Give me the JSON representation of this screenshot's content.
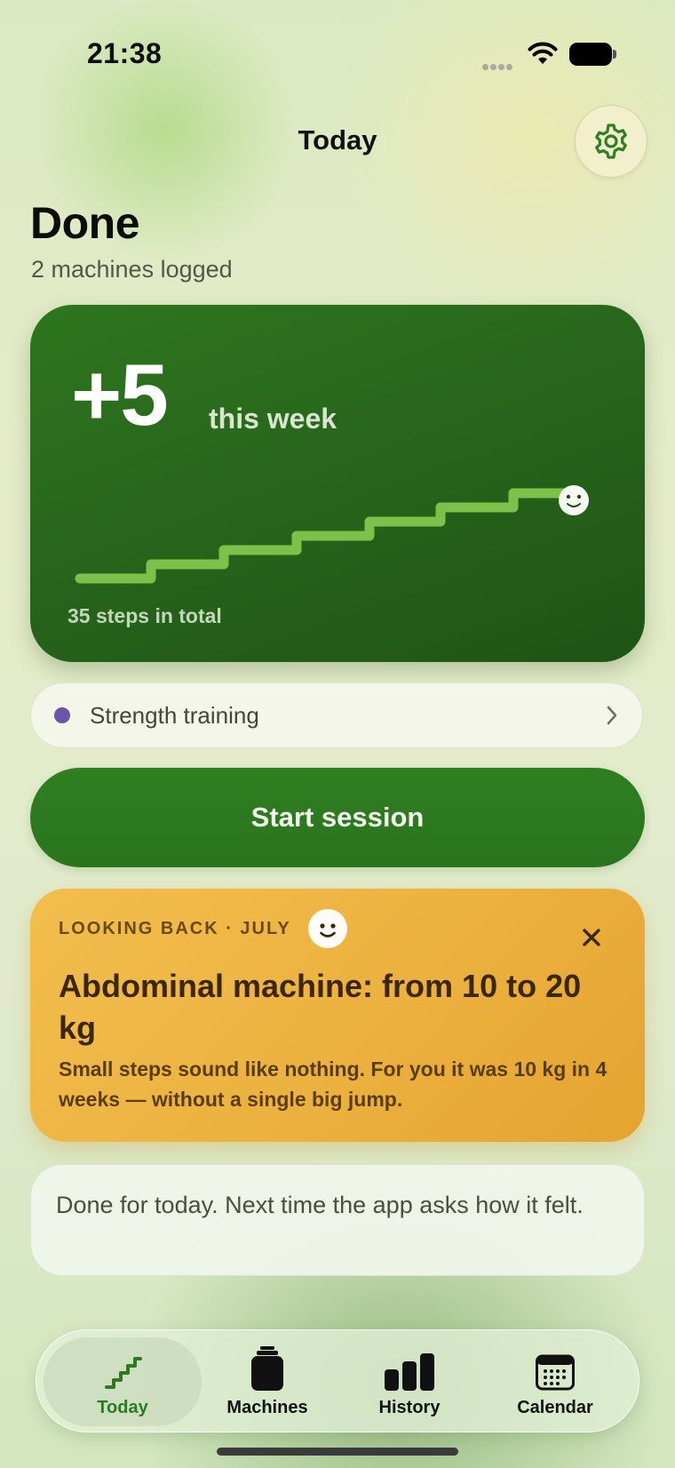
{
  "status_bar": {
    "time": "21:38"
  },
  "header": {
    "title": "Today"
  },
  "summary": {
    "title": "Done",
    "subtitle": "2 machines logged"
  },
  "hero": {
    "number": "+5",
    "unit": "this week",
    "footer": "35 steps in total",
    "accent_color": "#7cc24a",
    "card_color": "#2a6a1d"
  },
  "program": {
    "label": "Strength training",
    "dot_color": "#6b55a8"
  },
  "start_button": {
    "label": "Start session"
  },
  "memory_card": {
    "eyebrow": "LOOKING BACK · JULY",
    "headline": "Abdominal machine: from 10 to 20 kg",
    "body": "Small steps sound like nothing. For you it was 10 kg in 4 weeks — without a single big jump."
  },
  "note": {
    "text": "Done for today. Next time the app asks how it felt."
  },
  "tabs": [
    {
      "label": "Today",
      "icon": "stairs-icon",
      "active": true
    },
    {
      "label": "Machines",
      "icon": "machine-icon",
      "active": false
    },
    {
      "label": "History",
      "icon": "bar-chart-icon",
      "active": false
    },
    {
      "label": "Calendar",
      "icon": "calendar-icon",
      "active": false
    }
  ],
  "colors": {
    "primary_green": "#2f7f21",
    "accent_orange": "#ecb13f"
  }
}
